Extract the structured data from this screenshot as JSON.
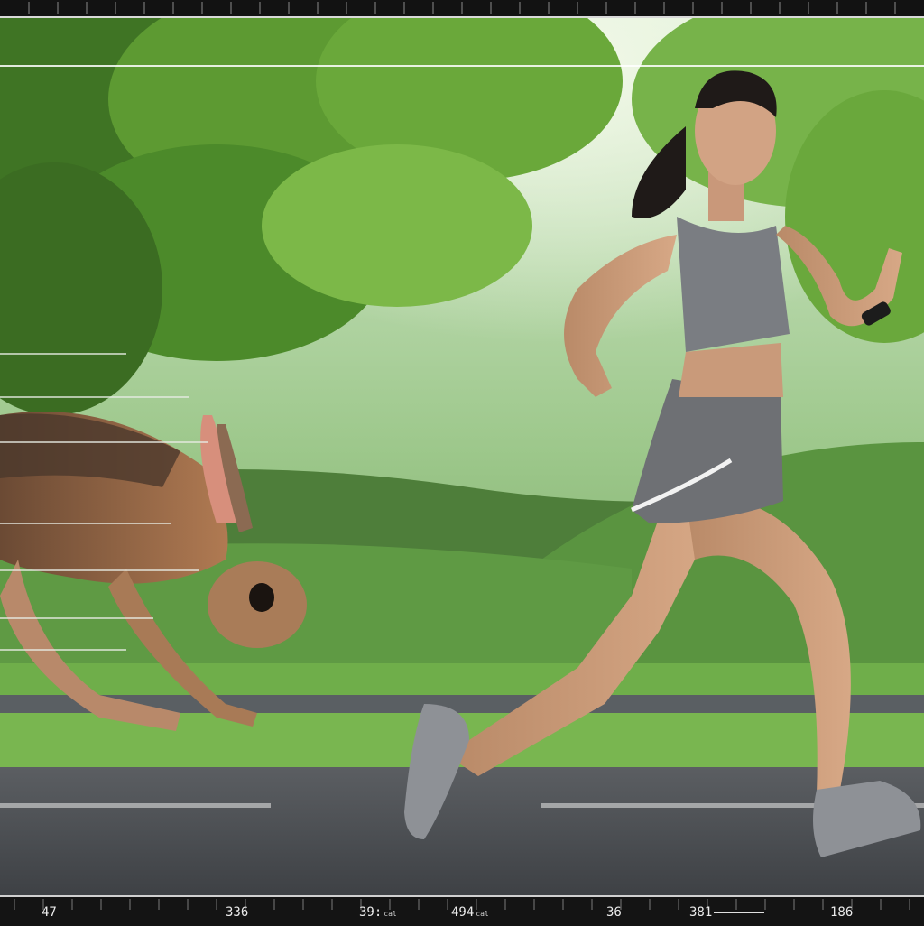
{
  "scene": {
    "subject_runner": "woman-runner",
    "subject_animal": "hare",
    "setting": "park-road"
  },
  "colors": {
    "bar_background": "#121212",
    "bar_border": "#d8d8d8",
    "foliage": "#5e9a35",
    "road": "#4b4e52",
    "sportswear": "#6e7074"
  },
  "readouts": [
    {
      "value": "47",
      "unit": ""
    },
    {
      "value": "336",
      "unit": ""
    },
    {
      "value": "39:",
      "unit": "cal"
    },
    {
      "value": "494",
      "unit": "cal"
    },
    {
      "value": "36",
      "unit": ""
    },
    {
      "value": "381",
      "unit": ""
    },
    {
      "value": "186",
      "unit": ""
    }
  ]
}
